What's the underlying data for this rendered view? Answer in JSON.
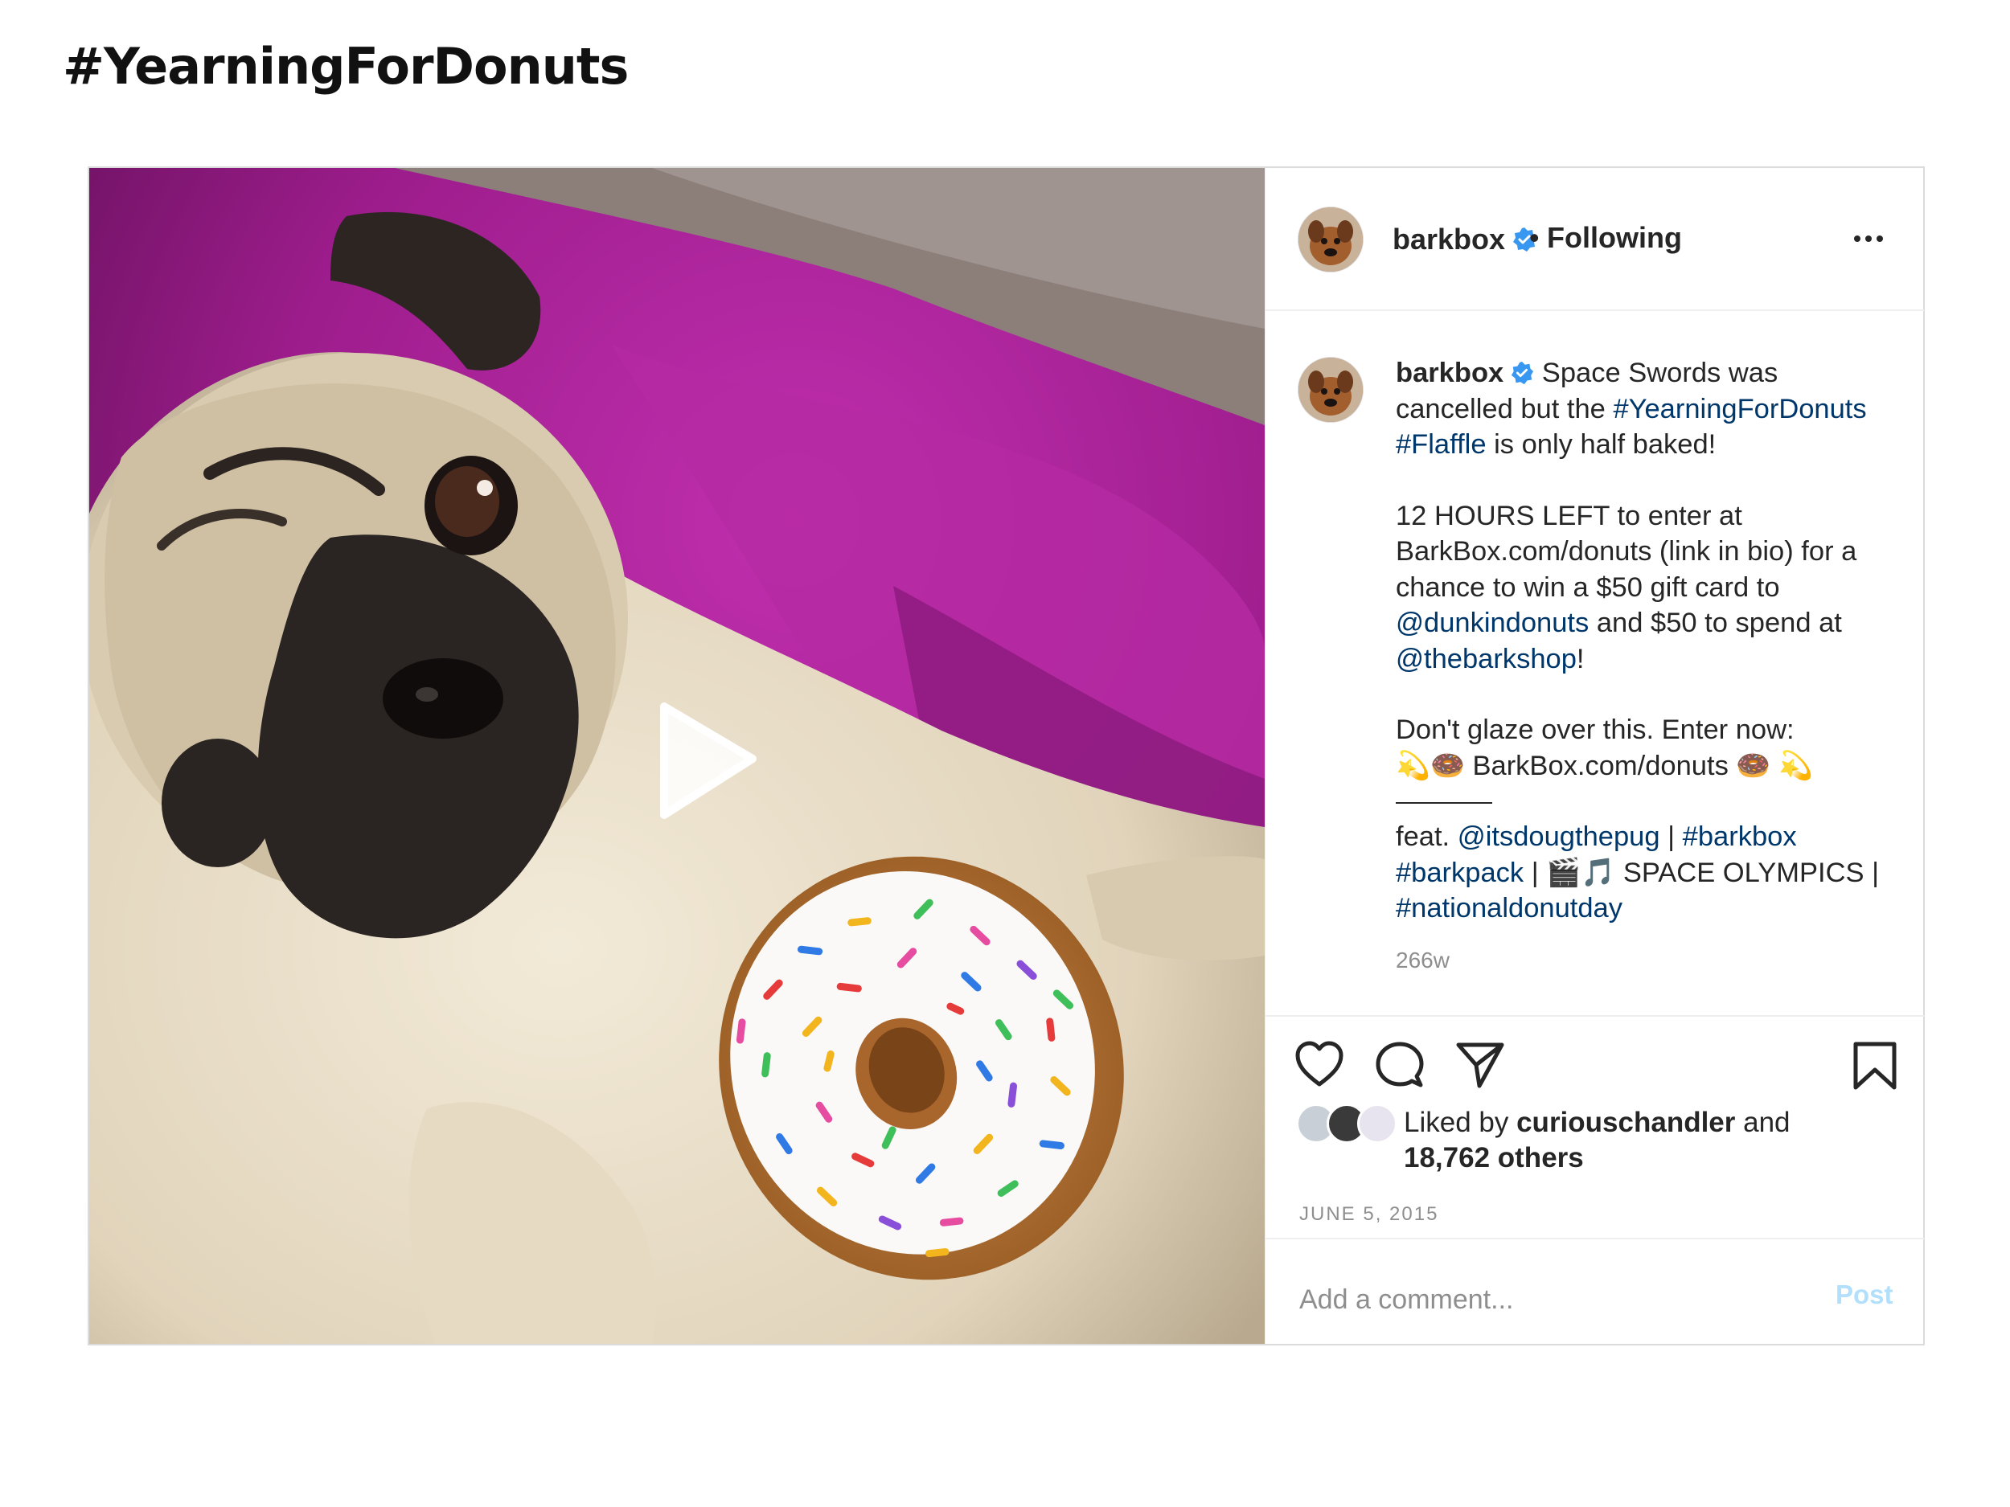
{
  "page": {
    "heading": "#YearningForDonuts"
  },
  "post": {
    "username": "barkbox",
    "follow_dot": "•",
    "follow_status": "Following",
    "more_icon": "more-options-icon",
    "caption": {
      "username": "barkbox",
      "line1_text": " Space Swords was cancelled but the ",
      "hashtag_yearning": "#YearningForDonuts",
      "hashtag_flaffle": "#Flaffle",
      "line1_end": " is only half baked!",
      "para2_a": "12 HOURS LEFT to enter at BarkBox.com/donuts (link in bio) for a chance to win a $50 gift card to ",
      "mention_dunkin": "@dunkindonuts",
      "para2_b": " and $50 to spend at ",
      "mention_barkshop": "@thebarkshop",
      "para2_c": "!",
      "para3": "Don't glaze over this. Enter now:",
      "para3_link": "💫🍩 BarkBox.com/donuts 🍩 💫",
      "feat_label": "feat. ",
      "mention_doug": "@itsdougthepug",
      "sep1": " | ",
      "hashtag_barkbox": "#barkbox",
      "hashtag_barkpack": "#barkpack",
      "space_olympics": " | 🎬🎵 SPACE OLYMPICS | ",
      "hashtag_nationaldonutday": "#nationaldonutday"
    },
    "age": "266w",
    "liked_by_prefix": "Liked by ",
    "liked_by_user": "curiouschandler",
    "liked_by_and": " and",
    "liked_by_others": "18,762 others",
    "date": "JUNE 5, 2015",
    "comment_placeholder": "Add a comment...",
    "post_button": "Post"
  },
  "icons": [
    "heart-icon",
    "comment-icon",
    "share-icon",
    "bookmark-icon",
    "play-icon",
    "verified-badge-icon"
  ],
  "colors": {
    "link": "#00376b",
    "verified": "#3897f0",
    "post_button": "#b2dffc",
    "muted": "#8e8e8e",
    "blanket": "#a0238f"
  }
}
